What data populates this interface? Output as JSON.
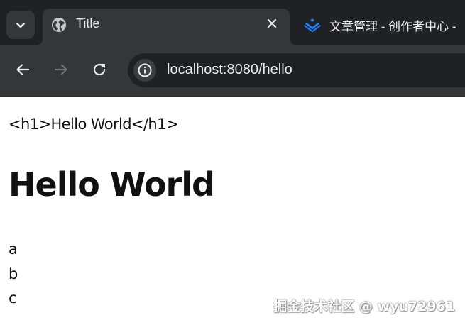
{
  "browser": {
    "tabs": [
      {
        "title": "Title",
        "favicon": "globe-icon",
        "active": true
      },
      {
        "title": "文章管理 - 创作者中心 -",
        "favicon": "juejin-logo-icon",
        "active": false
      }
    ],
    "address_bar": {
      "url": "localhost:8080/hello"
    },
    "colors": {
      "tabstrip": "#202124",
      "toolbar": "#35363a",
      "text": "#e8eaed",
      "juejin_blue": "#1e80ff"
    }
  },
  "page": {
    "raw_line": "<h1>Hello World</h1>",
    "heading": "Hello World",
    "lines": [
      "a",
      "b",
      "c"
    ]
  },
  "watermark": "掘金技术社区 @ wyu72961"
}
